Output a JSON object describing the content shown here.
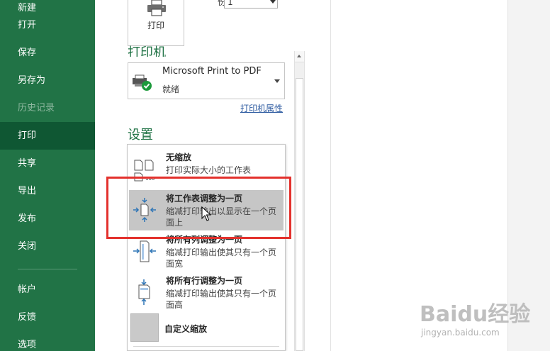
{
  "sidebar": {
    "items": [
      {
        "label": "新建",
        "state": "normal"
      },
      {
        "label": "打开",
        "state": "normal"
      },
      {
        "label": "保存",
        "state": "normal"
      },
      {
        "label": "另存为",
        "state": "normal"
      },
      {
        "label": "历史记录",
        "state": "disabled"
      },
      {
        "label": "打印",
        "state": "active"
      },
      {
        "label": "共享",
        "state": "normal"
      },
      {
        "label": "导出",
        "state": "normal"
      },
      {
        "label": "发布",
        "state": "normal"
      },
      {
        "label": "关闭",
        "state": "normal"
      },
      {
        "label": "帐户",
        "state": "normal"
      },
      {
        "label": "反馈",
        "state": "normal"
      },
      {
        "label": "选项",
        "state": "normal"
      }
    ]
  },
  "print": {
    "button_label": "打印",
    "copies_label": "份数",
    "copies_value": "1"
  },
  "printer": {
    "section_title": "打印机",
    "name": "Microsoft Print to PDF",
    "status": "就绪",
    "properties_link": "打印机属性"
  },
  "settings": {
    "section_title": "设置"
  },
  "scaling_options": [
    {
      "title": "无缩放",
      "description": "打印实际大小的工作表",
      "icon": "no-scaling-icon"
    },
    {
      "title": "将工作表调整为一页",
      "description": "缩减打印输出以显示在一个页面上",
      "icon": "fit-sheet-icon",
      "highlighted": true
    },
    {
      "title": "将所有列调整为一页",
      "description": "缩减打印输出使其只有一个页面宽",
      "icon": "fit-columns-icon"
    },
    {
      "title": "将所有行调整为一页",
      "description": "缩减打印输出使其只有一个页面高",
      "icon": "fit-rows-icon"
    },
    {
      "title": "自定义缩放",
      "icon": "custom-scaling-icon"
    }
  ],
  "watermark": {
    "text": "Baidu经验",
    "url": "jingyan.baidu.com"
  },
  "colors": {
    "sidebar_bg": "#217346",
    "sidebar_active": "#0f5733",
    "accent_green": "#217346",
    "link_blue": "#2c5aa0",
    "highlight_gray": "#c6c6c6",
    "annotation_red": "#e3312d"
  }
}
